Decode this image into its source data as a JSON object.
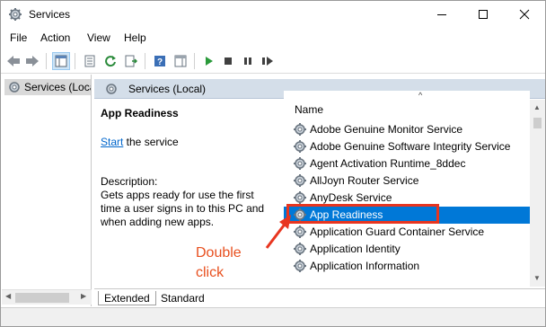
{
  "window": {
    "title": "Services",
    "minimize_icon": "minimize-icon",
    "maximize_icon": "maximize-icon",
    "close_icon": "close-icon"
  },
  "menu": [
    "File",
    "Action",
    "View",
    "Help"
  ],
  "toolbar": {
    "icons": [
      "back-arrow-icon",
      "forward-arrow-icon",
      "show-hide-tree-icon",
      "properties-icon",
      "refresh-icon",
      "export-list-icon",
      "help-icon",
      "show-action-pane-icon",
      "start-service-icon",
      "stop-service-icon",
      "pause-service-icon",
      "restart-service-icon"
    ]
  },
  "tree": {
    "item_label": "Services (Loca"
  },
  "pane": {
    "header_title": "Services (Local)"
  },
  "details": {
    "service_name": "App Readiness",
    "start_link": "Start",
    "start_rest": " the service",
    "description_label": "Description:",
    "description_text": "Gets apps ready for use the first time a user signs in to this PC and when adding new apps."
  },
  "list": {
    "column_name": "Name",
    "sort_indicator": "^",
    "rows": [
      {
        "name": "Adobe Genuine Monitor Service",
        "selected": false
      },
      {
        "name": "Adobe Genuine Software Integrity Service",
        "selected": false
      },
      {
        "name": "Agent Activation Runtime_8ddec",
        "selected": false
      },
      {
        "name": "AllJoyn Router Service",
        "selected": false
      },
      {
        "name": "AnyDesk Service",
        "selected": false
      },
      {
        "name": "App Readiness",
        "selected": true
      },
      {
        "name": "Application Guard Container Service",
        "selected": false
      },
      {
        "name": "Application Identity",
        "selected": false
      },
      {
        "name": "Application Information",
        "selected": false
      }
    ]
  },
  "annotation": {
    "line1": "Double",
    "line2": "click",
    "color": "#e8501f"
  },
  "tabs": [
    "Extended",
    "Standard"
  ],
  "colors": {
    "selection": "#0078d7",
    "highlight_box": "#e8351f",
    "pane_header": "#d4dee9"
  }
}
